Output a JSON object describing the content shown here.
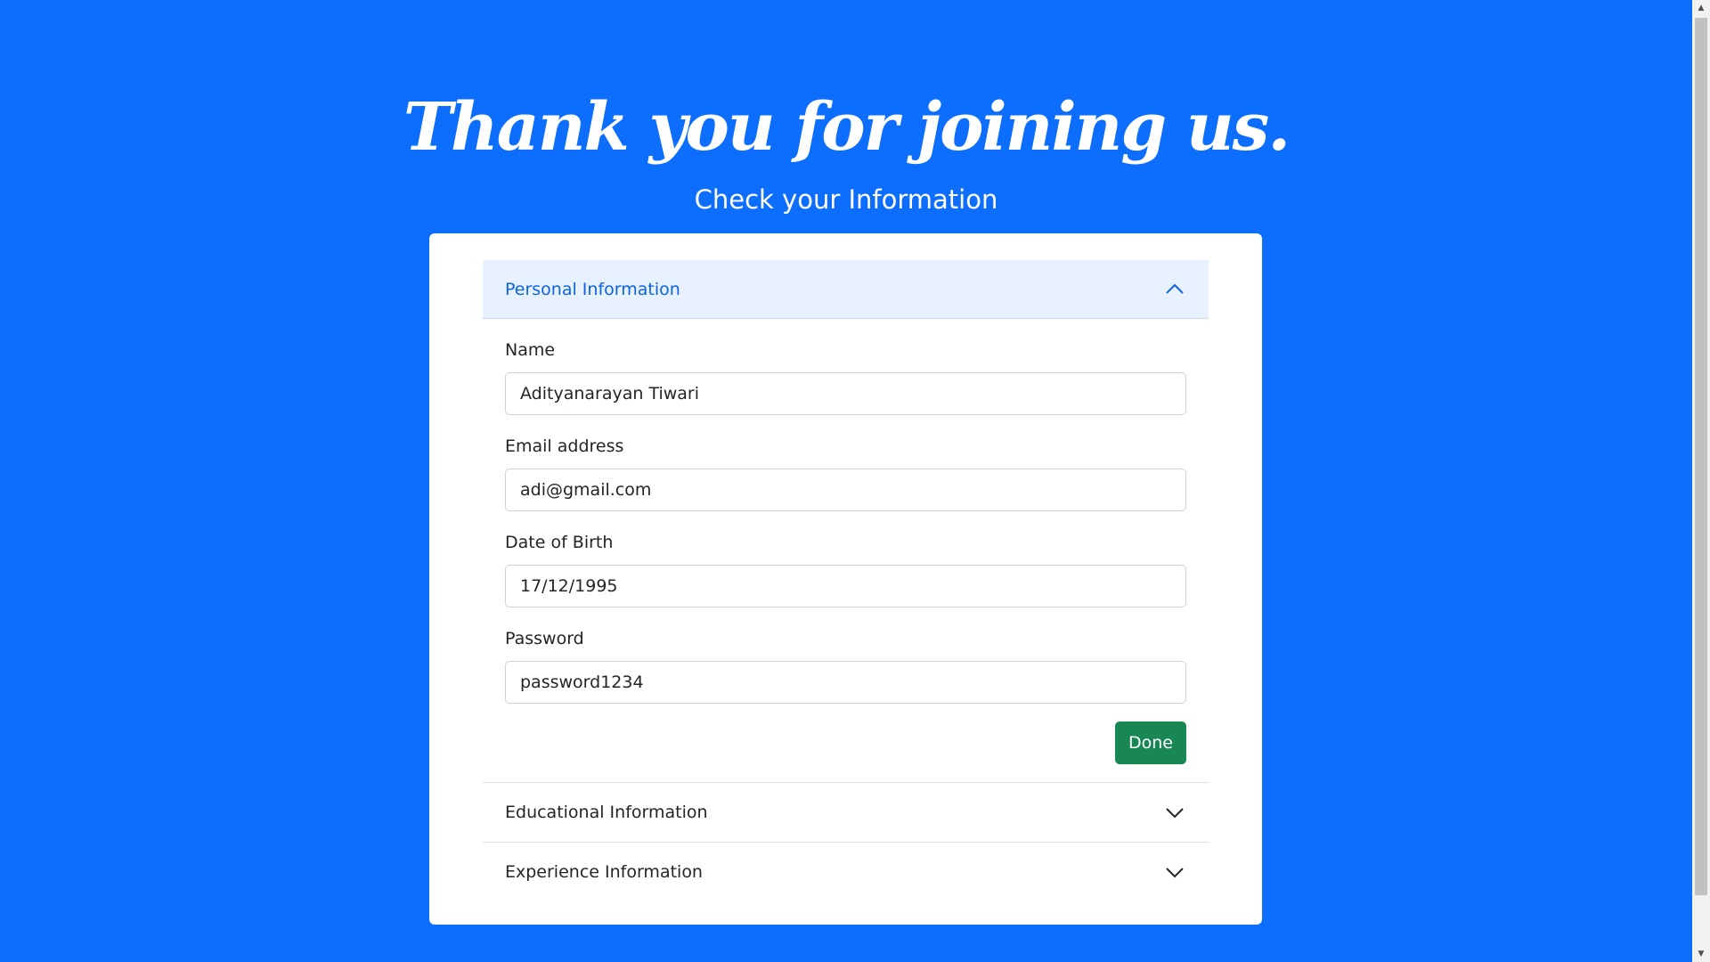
{
  "page": {
    "headline": "Thank you for joining us.",
    "subheadline": "Check your Information"
  },
  "accordion": {
    "personal": {
      "title": "Personal Information",
      "expanded": true,
      "fields": {
        "name": {
          "label": "Name",
          "value": "Adityanarayan Tiwari"
        },
        "email": {
          "label": "Email address",
          "value": "adi@gmail.com"
        },
        "dob": {
          "label": "Date of Birth",
          "value": "17/12/1995"
        },
        "password": {
          "label": "Password",
          "value": "password1234"
        }
      },
      "done_label": "Done"
    },
    "educational": {
      "title": "Educational Information",
      "expanded": false
    },
    "experience": {
      "title": "Experience Information",
      "expanded": false
    }
  },
  "colors": {
    "background": "#0d6efd",
    "accordion_active_bg": "#e7f1ff",
    "accordion_active_text": "#0c63e4",
    "done_button": "#198754"
  },
  "icons": {
    "expanded": "chevron-up-icon",
    "collapsed": "chevron-down-icon"
  }
}
